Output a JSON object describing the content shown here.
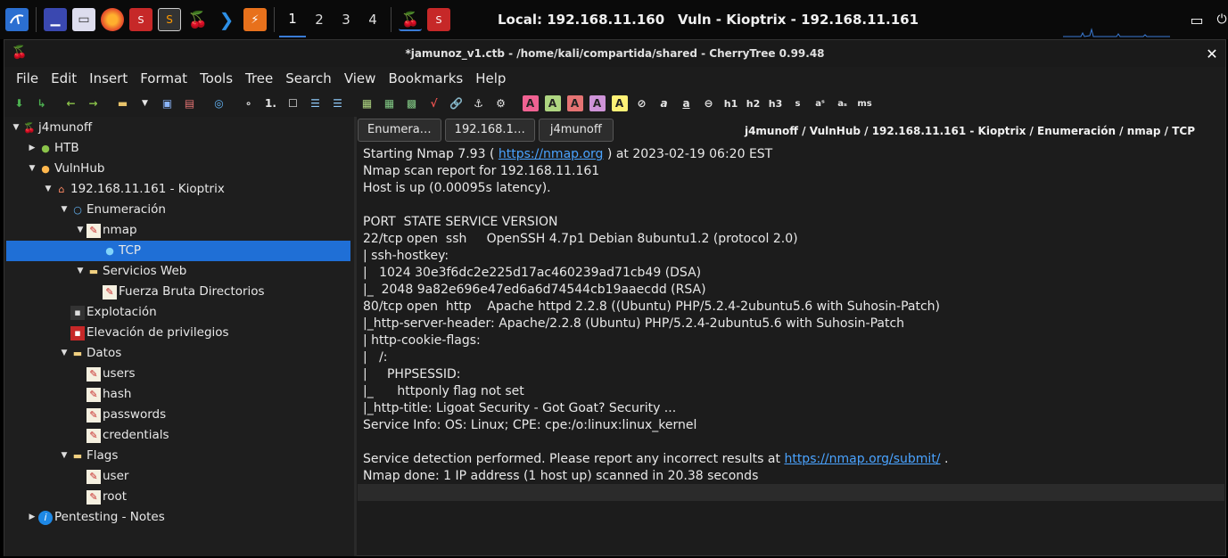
{
  "taskbar": {
    "workspaces": [
      "1",
      "2",
      "3",
      "4"
    ],
    "local_ip": "Local: 192.168.11.160",
    "vuln": "Vuln - Kioptrix - 192.168.11.161"
  },
  "window": {
    "title": "*jamunoz_v1.ctb - /home/kali/compartida/shared - CherryTree 0.99.48",
    "close": "✕"
  },
  "menu": [
    "File",
    "Edit",
    "Insert",
    "Format",
    "Tools",
    "Tree",
    "Search",
    "View",
    "Bookmarks",
    "Help"
  ],
  "toolbar": {
    "format_labels": [
      "h1",
      "h2",
      "h3",
      "s",
      "ms"
    ]
  },
  "tree": [
    {
      "label": "j4munoff",
      "icon": "cherry-icon"
    },
    {
      "label": "HTB",
      "icon": "green-cherry-icon"
    },
    {
      "label": "VulnHub",
      "icon": "orange-cherry-icon"
    },
    {
      "label": "192.168.11.161 - Kioptrix",
      "icon": "home-icon"
    },
    {
      "label": "Enumeración",
      "icon": "magnifier-icon"
    },
    {
      "label": "nmap",
      "icon": "note-icon"
    },
    {
      "label": "TCP",
      "icon": "globe-icon"
    },
    {
      "label": "Servicios Web",
      "icon": "folder-icon"
    },
    {
      "label": "Fuerza Bruta Directorios",
      "icon": "note-icon"
    },
    {
      "label": "Explotación",
      "icon": "terminal-icon"
    },
    {
      "label": "Elevación de privilegios",
      "icon": "red-terminal-icon"
    },
    {
      "label": "Datos",
      "icon": "folder-icon"
    },
    {
      "label": "users",
      "icon": "note-icon"
    },
    {
      "label": "hash",
      "icon": "note-icon"
    },
    {
      "label": "passwords",
      "icon": "note-icon"
    },
    {
      "label": "credentials",
      "icon": "note-icon"
    },
    {
      "label": "Flags",
      "icon": "folder-icon"
    },
    {
      "label": "user",
      "icon": "note-icon"
    },
    {
      "label": "root",
      "icon": "note-icon"
    },
    {
      "label": "Pentesting - Notes",
      "icon": "info-icon"
    }
  ],
  "tabs": [
    "Enumera…",
    "192.168.1…",
    "j4munoff"
  ],
  "breadcrumb": "j4munoff / VulnHub / 192.168.11.161 - Kioptrix / Enumeración / nmap / TCP",
  "editor": {
    "l1_pre": "Starting Nmap 7.93 ( ",
    "l1_link": "https://nmap.org",
    "l1_post": " ) at 2023-02-19 06:20 EST",
    "l2": "Nmap scan report for 192.168.11.161",
    "l3": "Host is up (0.00095s latency).",
    "l5": "PORT  STATE SERVICE VERSION",
    "l6": "22/tcp open  ssh     OpenSSH 4.7p1 Debian 8ubuntu1.2 (protocol 2.0)",
    "l7": "| ssh-hostkey:",
    "l8": "|   1024 30e3f6dc2e225d17ac460239ad71cb49 (DSA)",
    "l9": "|_  2048 9a82e696e47ed6a6d74544cb19aaecdd (RSA)",
    "l10": "80/tcp open  http    Apache httpd 2.2.8 ((Ubuntu) PHP/5.2.4-2ubuntu5.6 with Suhosin-Patch)",
    "l11": "|_http-server-header: Apache/2.2.8 (Ubuntu) PHP/5.2.4-2ubuntu5.6 with Suhosin-Patch",
    "l12": "| http-cookie-flags:",
    "l13": "|   /:",
    "l14": "|     PHPSESSID:",
    "l15": "|_      httponly flag not set",
    "l16": "|_http-title: Ligoat Security - Got Goat? Security ...",
    "l17": "Service Info: OS: Linux; CPE: cpe:/o:linux:linux_kernel",
    "l19_pre": "Service detection performed. Please report any incorrect results at ",
    "l19_link": "https://nmap.org/submit/",
    "l19_post": " .",
    "l20": "Nmap done: 1 IP address (1 host up) scanned in 20.38 seconds"
  },
  "colors": {
    "selection": "#1f6fd6",
    "link": "#4aa3ff",
    "accent": "#3a7bd5"
  }
}
